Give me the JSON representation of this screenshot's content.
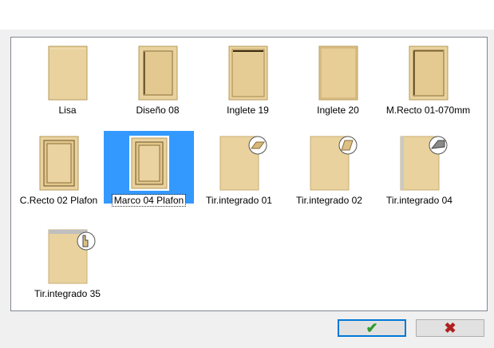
{
  "items": [
    {
      "label": "Lisa",
      "icon": "door-plain-icon"
    },
    {
      "label": "Diseño 08",
      "icon": "door-panel-icon"
    },
    {
      "label": "Inglete 19",
      "icon": "door-mitre-icon"
    },
    {
      "label": "Inglete 20",
      "icon": "door-mitre-flat-icon"
    },
    {
      "label": "M.Recto 01-070mm",
      "icon": "door-frame-icon"
    },
    {
      "label": "C.Recto 02 Plafon",
      "icon": "door-raised-panel-icon"
    },
    {
      "label": "Marco 04 Plafon",
      "icon": "door-raised-panel-icon",
      "selected": true
    },
    {
      "label": "Tir.integrado 01",
      "icon": "door-integrated-handle-icon"
    },
    {
      "label": "Tir.integrado 02",
      "icon": "door-integrated-handle-icon"
    },
    {
      "label": "Tir.integrado 04",
      "icon": "door-integrated-handle-icon"
    },
    {
      "label": "Tir.integrado 35",
      "icon": "door-integrated-handle-icon"
    }
  ],
  "buttons": {
    "ok_glyph": "✔",
    "cancel_glyph": "✖"
  },
  "colors": {
    "wood": "#e8cf98",
    "wood_dark": "#b89a5a",
    "selection": "#3399ff",
    "ok": "#2e9a2e",
    "cancel": "#b02020"
  }
}
